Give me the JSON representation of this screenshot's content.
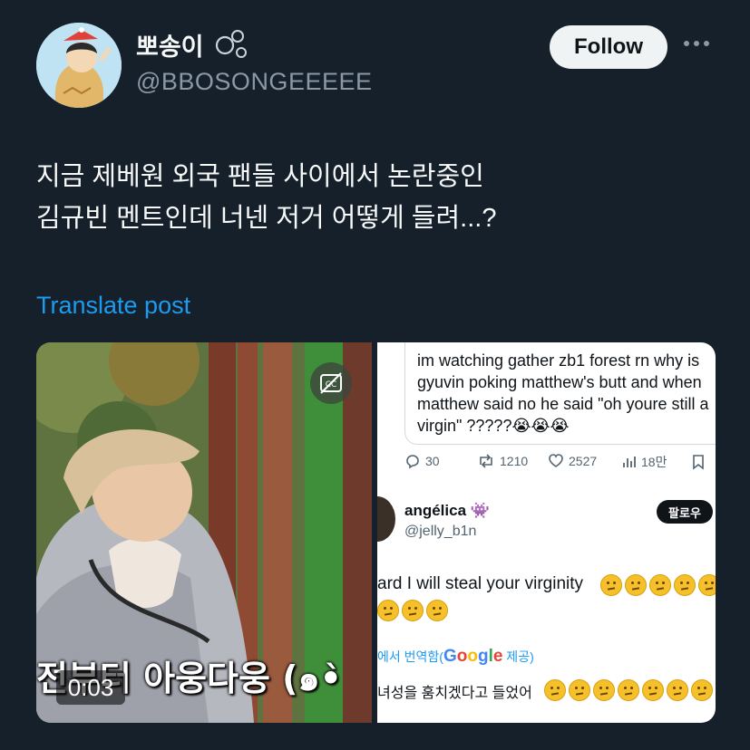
{
  "author": {
    "display_name": "뽀송이",
    "handle": "@BBOSONGEEEEE"
  },
  "header": {
    "follow_label": "Follow"
  },
  "post": {
    "lines": [
      "지금 제베원 외국 팬들 사이에서 논란중인",
      "김규빈 멘트인데 너넨 저거 어떻게 들려...?"
    ],
    "translate_label": "Translate post"
  },
  "media": {
    "video": {
      "caption": "전부터 아웅다웅 (๑•̀",
      "duration": "0:03"
    },
    "screenshot": {
      "quoted_text": "im watching gather zb1 forest rn why is gyuvin poking matthew's butt and when matthew said no he said \"oh youre still a virgin\" ?????😭😭😭",
      "stats": {
        "replies": "30",
        "retweets": "1210",
        "likes": "2527",
        "views": "18만"
      },
      "reply": {
        "name": "angélica 👾",
        "handle": "@jelly_b1n",
        "follow_label": "팔로우",
        "text": "ard I will steal your virginity",
        "translated_by_prefix": "에서 번역함(",
        "translated_by_brand": "Google",
        "translated_by_suffix": " 제공)",
        "translated_text": "녀성을 훔치겠다고 들었어"
      }
    }
  },
  "colors": {
    "background": "#15202b",
    "link": "#1d9bf0",
    "secondary_text": "#8b98a5"
  }
}
